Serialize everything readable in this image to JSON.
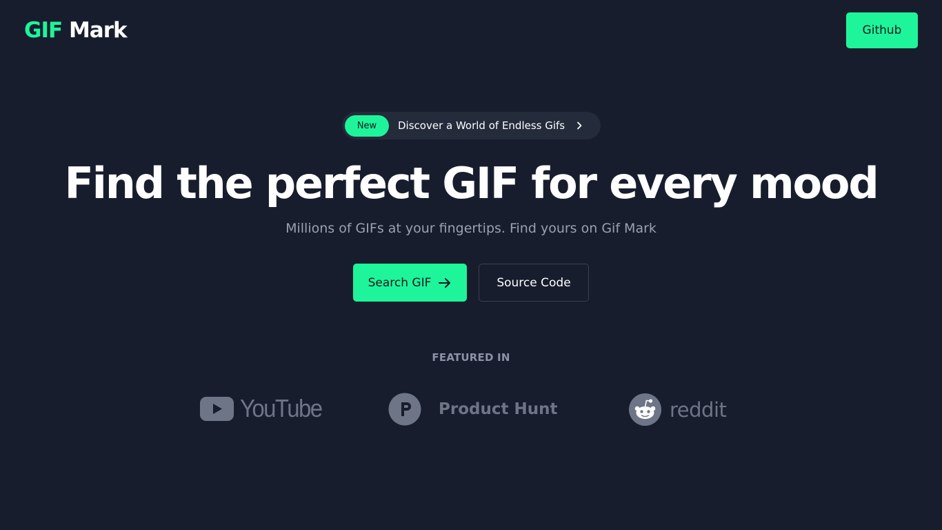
{
  "header": {
    "logo_accent": "GIF",
    "logo_rest": " Mark",
    "github_label": "Github"
  },
  "announcement": {
    "badge": "New",
    "text": "Discover a World of Endless Gifs"
  },
  "hero": {
    "title": "Find the perfect GIF for every mood",
    "subtitle": "Millions of GIFs at your fingertips. Find yours on Gif Mark"
  },
  "cta": {
    "search_label": "Search GIF",
    "source_label": "Source Code"
  },
  "featured": {
    "label": "FEATURED IN",
    "brands": [
      "YouTube",
      "Product Hunt",
      "reddit"
    ]
  },
  "colors": {
    "background": "#181d2e",
    "accent": "#1ef59b",
    "muted": "#6e7586"
  },
  "icons": [
    "chevron-right-icon",
    "arrow-right-icon",
    "youtube-play-icon",
    "product-hunt-icon",
    "reddit-alien-icon"
  ]
}
